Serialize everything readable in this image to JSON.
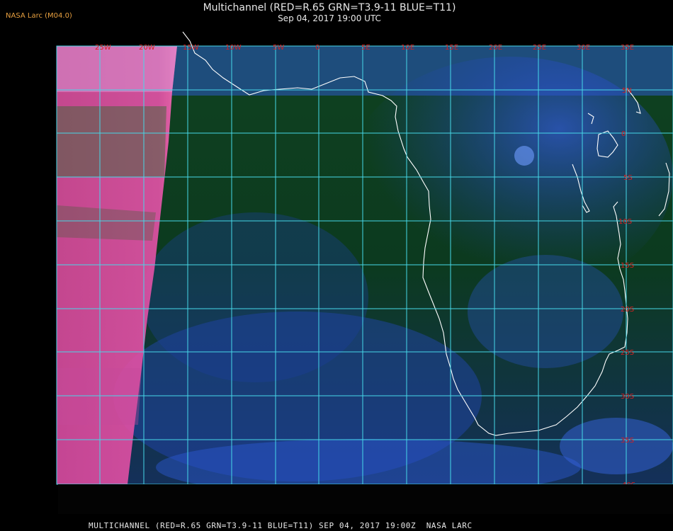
{
  "credit": "NASA Larc (M04.0)",
  "title": "Multichannel (RED=R.65 GRN=T3.9-11 BLUE=T11)",
  "subtitle": "Sep 04, 2017 19:00 UTC",
  "footer": "MULTICHANNEL (RED=R.65 GRN=T3.9-11 BLUE=T11) SEP 04, 2017 19:00Z  NASA LARC",
  "colors": {
    "grid": "#46d8e8",
    "coastline": "#ffffff",
    "labels": "#d62020",
    "ocean": "#0d3a1c",
    "cloud": "#3a63e6",
    "dayside_edge": "#ff5fb0"
  },
  "longitude_labels": [
    "25W",
    "20W",
    "15W",
    "10W",
    "5W",
    "0",
    "5E",
    "10E",
    "15E",
    "20E",
    "25E",
    "30E",
    "35E"
  ],
  "latitude_labels": [
    "5N",
    "0",
    "5S",
    "10S",
    "15S",
    "20S",
    "25S",
    "30S",
    "35S",
    "40S"
  ]
}
